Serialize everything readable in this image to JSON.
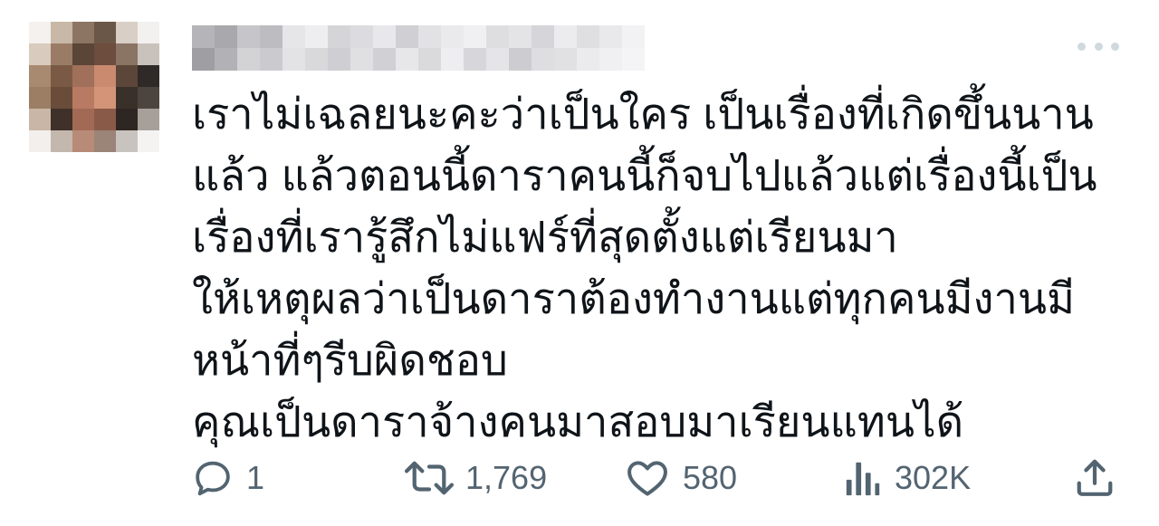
{
  "tweet": {
    "lines": [
      "เราไม่เฉลยนะคะว่าเป็นใคร เป็นเรื่องที่เกิดขึ้นนาน",
      "แล้ว แล้วตอนนี้ดาราคนนี้ก็จบไปแล้วแต่เรื่องนี้เป็น",
      "เรื่องที่เรารู้สึกไม่แฟร์ที่สุดตั้งแต่เรียนมา",
      "ให้เหตุผลว่าเป็นดาราต้องทำงานแต่ทุกคนมีงานมี",
      "หน้าที่ๆรีบผิดชอบ",
      "คุณเป็นดาราจ้างคนมาสอบมาเรียนแทนได้"
    ]
  },
  "actions": {
    "replies": "1",
    "retweets": "1,769",
    "likes": "580",
    "views": "302K"
  },
  "colors": {
    "text": "#0f1419",
    "muted": "#536471",
    "more_dots": "#cfd9de"
  },
  "icons": {
    "more": "more-dots-icon",
    "reply": "reply-bubble-icon",
    "retweet": "retweet-arrows-icon",
    "like": "heart-icon",
    "views": "bar-chart-icon",
    "share": "share-upload-icon"
  }
}
